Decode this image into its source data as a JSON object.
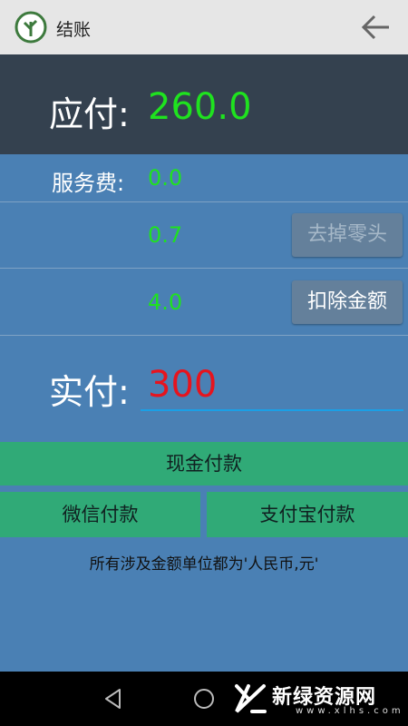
{
  "header": {
    "title": "结账"
  },
  "amount_due": {
    "label": "应付:",
    "value": "260.0"
  },
  "service_fee": {
    "label": "服务费:",
    "value": "0.0"
  },
  "rounding": {
    "value": "0.7",
    "button_label": "去掉零头"
  },
  "deduction": {
    "value": "4.0",
    "button_label": "扣除金额"
  },
  "amount_paid": {
    "label": "实付:",
    "value": "300"
  },
  "payment": {
    "cash_label": "现金付款",
    "wechat_label": "微信付款",
    "alipay_label": "支付宝付款"
  },
  "note": "所有涉及金额单位都为'人民币,元'",
  "watermark": {
    "text": "新绿资源网",
    "sub": "www.xlhs.com"
  },
  "colors": {
    "header_bg": "#e6e6e6",
    "due_panel_bg": "#34414f",
    "body_bg": "#4a80b4",
    "green_value": "#1fe21f",
    "red_value": "#e6141e",
    "pay_button": "#30aa77",
    "input_underline": "#1aa0e6"
  },
  "icons": [
    "app-logo-icon",
    "back-arrow-icon",
    "nav-back-icon",
    "nav-home-icon",
    "watermark-logo-icon"
  ]
}
